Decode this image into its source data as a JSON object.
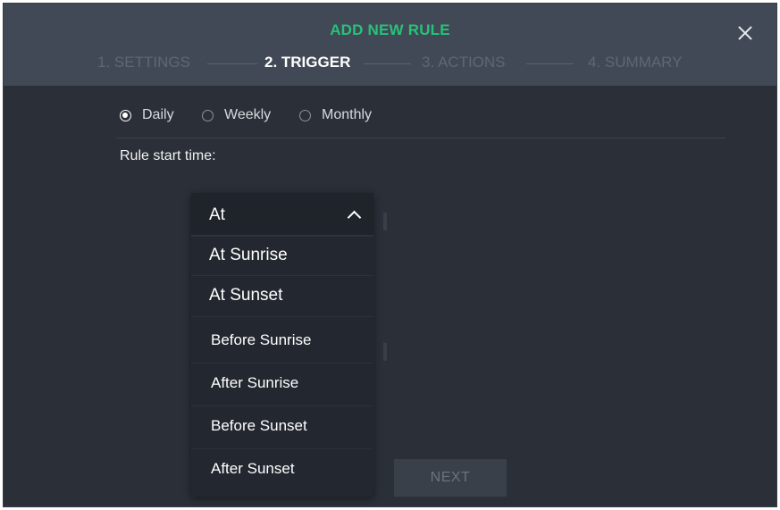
{
  "dialog": {
    "title": "ADD NEW RULE",
    "steps": [
      {
        "label": "1. SETTINGS",
        "active": false
      },
      {
        "label": "2. TRIGGER",
        "active": true
      },
      {
        "label": "3. ACTIONS",
        "active": false
      },
      {
        "label": "4. SUMMARY",
        "active": false
      }
    ],
    "close_icon": "close-icon"
  },
  "frequency": {
    "options": [
      "Daily",
      "Weekly",
      "Monthly"
    ],
    "selected": "Daily"
  },
  "rule_start": {
    "label": "Rule start time:"
  },
  "dropdown": {
    "selected": "At",
    "icon": "chevron-up-icon",
    "options": [
      "At Sunrise",
      "At Sunset",
      "Before Sunrise",
      "After Sunrise",
      "Before Sunset",
      "After Sunset"
    ]
  },
  "footer": {
    "next_label": "NEXT"
  },
  "colors": {
    "accent": "#27c27a",
    "header_bg": "#404955",
    "body_bg": "#2b2f37"
  }
}
